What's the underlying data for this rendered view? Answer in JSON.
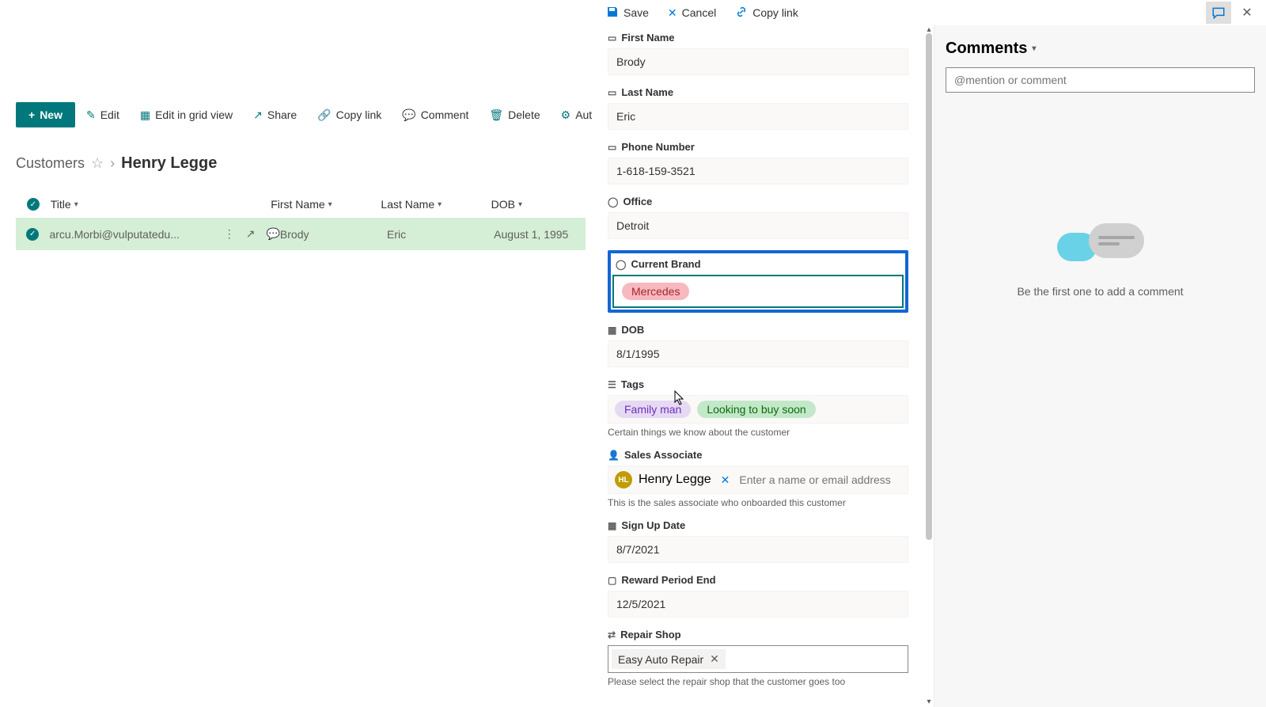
{
  "panel_top": {
    "save": "Save",
    "cancel": "Cancel",
    "copy_link": "Copy link"
  },
  "toolbar": {
    "new": "New",
    "edit": "Edit",
    "grid_edit": "Edit in grid view",
    "share": "Share",
    "copy_link": "Copy link",
    "comment": "Comment",
    "delete": "Delete",
    "automate": "Automate"
  },
  "breadcrumb": {
    "list": "Customers",
    "current": "Henry Legge"
  },
  "grid": {
    "cols": {
      "title": "Title",
      "first": "First Name",
      "last": "Last Name",
      "dob": "DOB"
    },
    "row": {
      "title": "arcu.Morbi@vulputatedu...",
      "first": "Brody",
      "last": "Eric",
      "dob": "August 1, 1995"
    }
  },
  "form": {
    "first_name": {
      "label": "First Name",
      "value": "Brody"
    },
    "last_name": {
      "label": "Last Name",
      "value": "Eric"
    },
    "phone": {
      "label": "Phone Number",
      "value": "1-618-159-3521"
    },
    "office": {
      "label": "Office",
      "value": "Detroit"
    },
    "brand": {
      "label": "Current Brand",
      "value": "Mercedes"
    },
    "dob": {
      "label": "DOB",
      "value": "8/1/1995"
    },
    "tags": {
      "label": "Tags",
      "values": [
        "Family man",
        "Looking to buy soon"
      ],
      "help": "Certain things we know about the customer"
    },
    "associate": {
      "label": "Sales Associate",
      "name": "Henry Legge",
      "initials": "HL",
      "placeholder": "Enter a name or email address",
      "help": "This is the sales associate who onboarded this customer"
    },
    "signup": {
      "label": "Sign Up Date",
      "value": "8/7/2021"
    },
    "reward": {
      "label": "Reward Period End",
      "value": "12/5/2021"
    },
    "repair": {
      "label": "Repair Shop",
      "value": "Easy Auto Repair",
      "help": "Please select the repair shop that the customer goes too"
    }
  },
  "comments": {
    "title": "Comments",
    "placeholder": "@mention or comment",
    "empty": "Be the first one to add a comment"
  }
}
